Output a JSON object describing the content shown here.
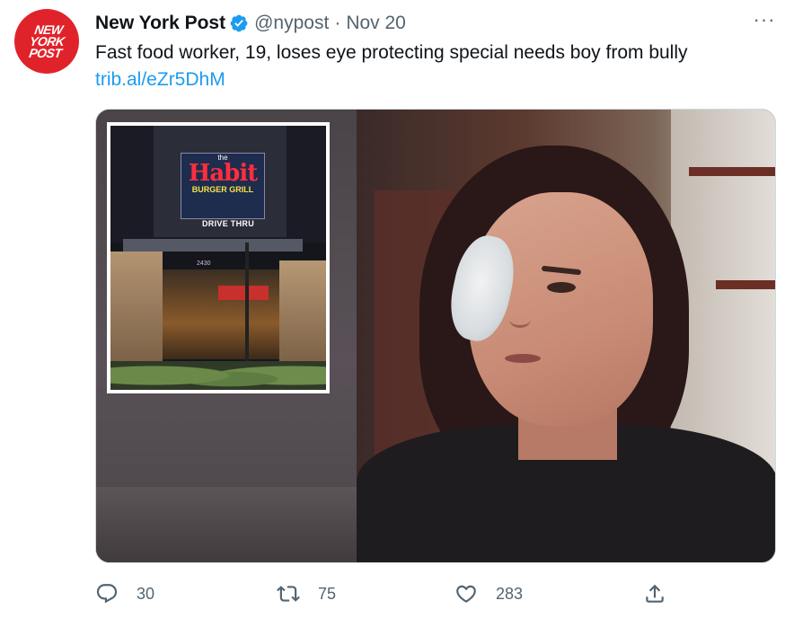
{
  "tweet": {
    "avatar_text": [
      "NEW",
      "YORK",
      "POST"
    ],
    "display_name": "New York Post",
    "handle": "@nypost",
    "separator": "·",
    "date": "Nov 20",
    "more_label": "···",
    "text": "Fast food worker, 19, loses eye protecting special needs boy from bully",
    "link": "trib.al/eZr5DhM"
  },
  "media": {
    "inset_sign": {
      "the": "the",
      "name": "Habit",
      "sub": "BURGER GRILL",
      "drive": "DRIVE THRU",
      "address": "2430"
    }
  },
  "actions": {
    "reply_count": "30",
    "retweet_count": "75",
    "like_count": "283"
  },
  "icons": {
    "verified": "verified-badge-icon",
    "reply": "reply-icon",
    "retweet": "retweet-icon",
    "like": "heart-icon",
    "share": "share-icon"
  },
  "colors": {
    "brand_red": "#e0232b",
    "link_blue": "#1d9bf0",
    "secondary_text": "#536471",
    "verified_blue": "#1d9bf0"
  }
}
